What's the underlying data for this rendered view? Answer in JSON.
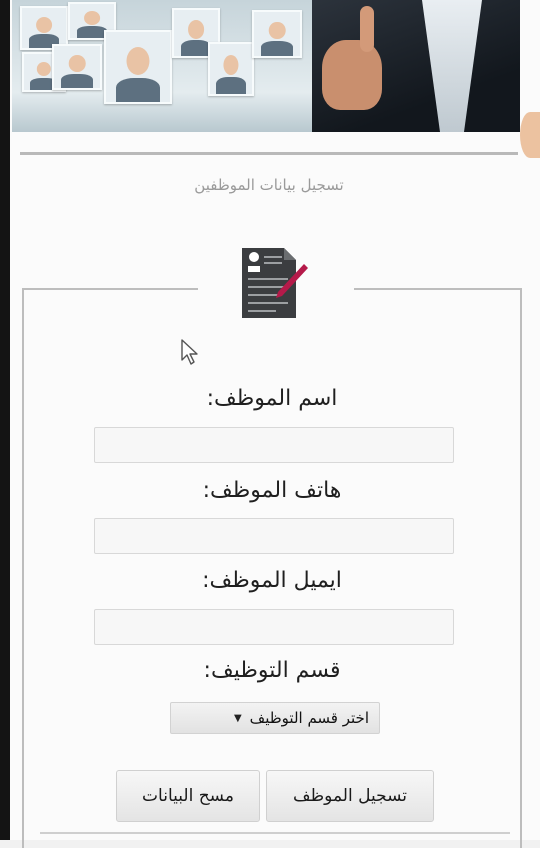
{
  "banner": {
    "image": "employees-banner"
  },
  "page": {
    "title": "تسجيل بيانات الموظفين"
  },
  "form": {
    "icon": "document-pen-icon",
    "fields": [
      {
        "label": "اسم الموظف:",
        "value": "",
        "placeholder": ""
      },
      {
        "label": "هاتف الموظف:",
        "value": "",
        "placeholder": ""
      },
      {
        "label": "ايميل الموظف:",
        "value": "",
        "placeholder": ""
      }
    ],
    "department": {
      "label": "قسم التوظيف:",
      "selected": "اختر قسم التوظيف"
    },
    "buttons": {
      "register": "تسجيل الموظف",
      "clear": "مسح البيانات"
    }
  }
}
